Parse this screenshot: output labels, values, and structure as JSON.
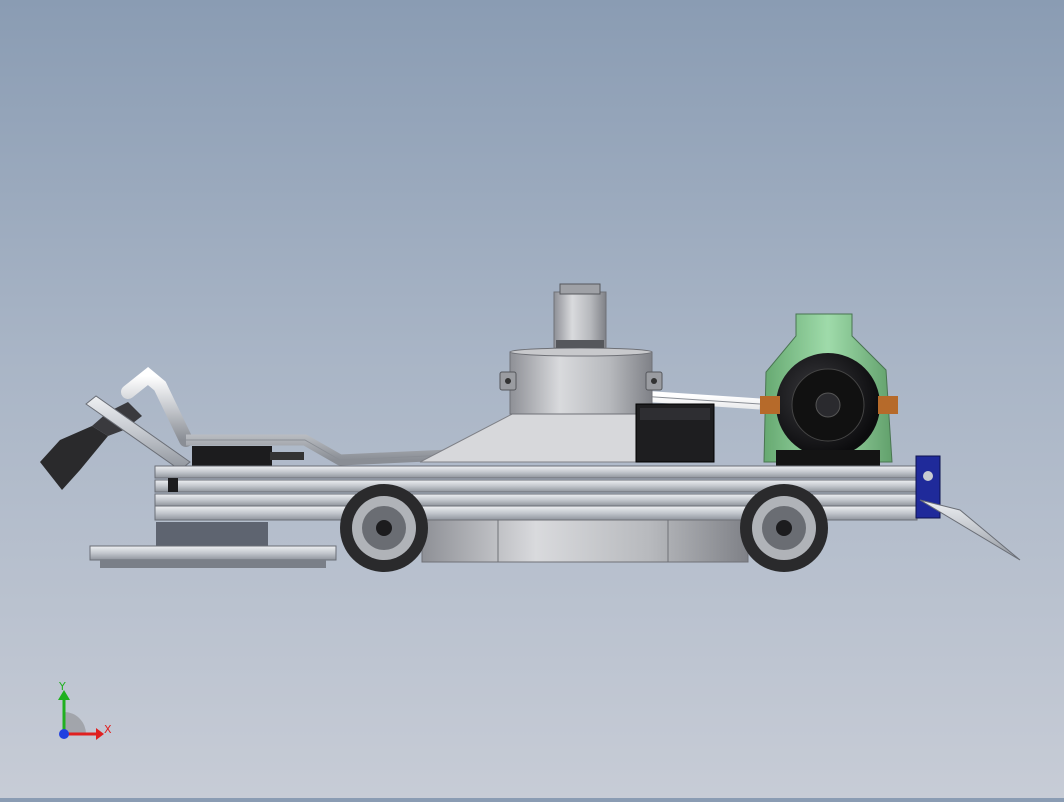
{
  "viewport": {
    "background_top": "#8a9cb3",
    "background_bottom": "#c7ccd6"
  },
  "triad": {
    "x_label": "X",
    "y_label": "Y",
    "x_color": "#e02020",
    "y_color": "#20b020",
    "z_color": "#2040e0"
  },
  "colors": {
    "aluminum": "#c9ccd1",
    "frame_dark": "#5e6470",
    "motor_black": "#1c1c1e",
    "tank_green": "#7fd18c",
    "bracket_blue": "#1f2a9a",
    "tire": "#2a2a2c"
  },
  "icons": [
    "coordinate-triad-icon"
  ]
}
